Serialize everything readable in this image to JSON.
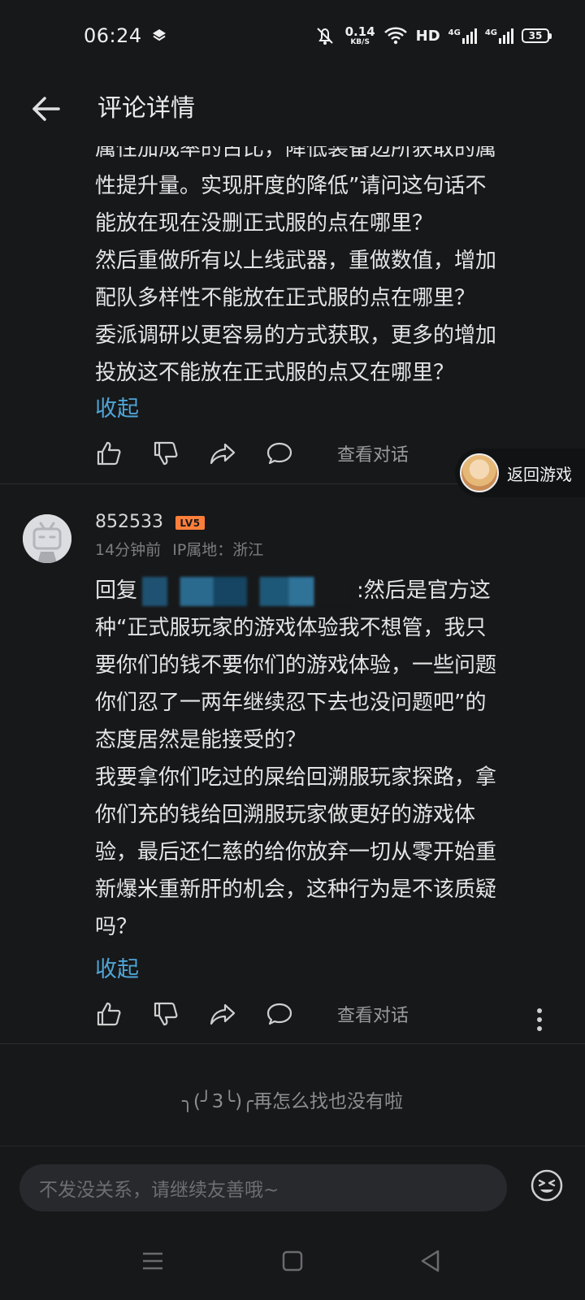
{
  "status_bar": {
    "time": "06:24",
    "net_speed": "0.14",
    "net_unit": "KB/S",
    "hd_label": "HD",
    "signal_label": "4G",
    "battery": "35"
  },
  "header": {
    "title": "评论详情"
  },
  "comment1": {
    "text_lines": [
      "属性加成率的占比，降低装备边所获取的属",
      "性提升量。实现肝度的降低”请问这句话不",
      "能放在现在没删正式服的点在哪里？",
      "然后重做所有以上线武器，重做数值，增加",
      "配队多样性不能放在正式服的点在哪里？",
      "委派调研以更容易的方式获取，更多的增加",
      "投放这不能放在正式服的点又在哪里？"
    ],
    "collapse_label": "收起",
    "view_chat_label": "查看对话"
  },
  "floating": {
    "return_game_label": "返回游戏"
  },
  "comment2": {
    "username": "852533",
    "level": "LV5",
    "time": "14分钟前",
    "ip_location": "IP属地：浙江",
    "reply_prefix": "回复",
    "first_line_rest": ":然后是官方这",
    "text_lines": [
      "种“正式服玩家的游戏体验我不想管，我只",
      "要你们的钱不要你们的游戏体验，一些问题",
      "你们忍了一两年继续忍下去也没问题吧”的",
      "态度居然是能接受的？",
      "我要拿你们吃过的屎给回溯服玩家探路，拿",
      "你们充的钱给回溯服玩家做更好的游戏体",
      "验，最后还仁慈的给你放弃一切从零开始重",
      "新爆米重新肝的机会，这种行为是不该质疑",
      "吗？"
    ],
    "collapse_label": "收起",
    "view_chat_label": "查看对话"
  },
  "end_message": "╮(╯3╰)╭再怎么找也没有啦",
  "input": {
    "placeholder": "不发没关系，请继续友善哦~"
  },
  "icons": {
    "back": "arrow-left-icon",
    "like": "thumbs-up-icon",
    "dislike": "thumbs-down-icon",
    "share": "share-icon",
    "comment": "comment-bubble-icon",
    "more": "more-vertical-icon",
    "emoji": "emoji-icon"
  },
  "colors": {
    "background": "#17181a",
    "accent_link": "#4fa5d6",
    "level_badge": "#ff7f3a"
  }
}
